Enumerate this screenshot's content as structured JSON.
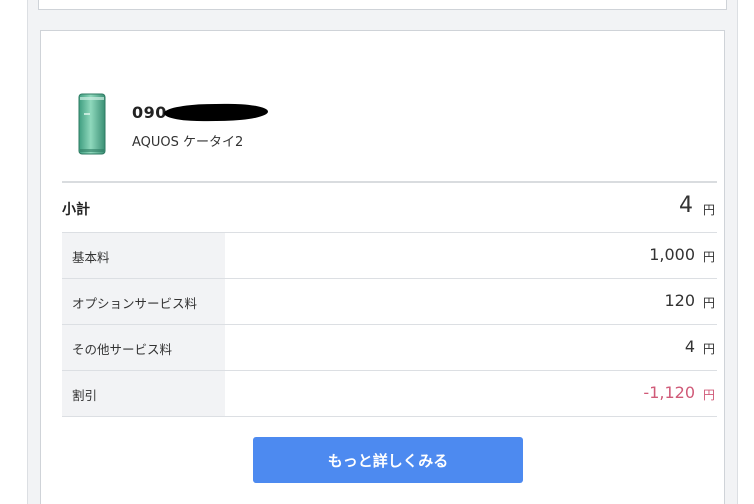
{
  "device": {
    "phone_number_prefix": "090",
    "model_name": "AQUOS ケータイ2",
    "icon": "flip-phone-icon"
  },
  "summary": {
    "subtotal_label": "小計",
    "subtotal_value": "4",
    "currency_unit": "円"
  },
  "breakdown": [
    {
      "label": "基本料",
      "value": "1,000",
      "unit": "円"
    },
    {
      "label": "オプションサービス料",
      "value": "120",
      "unit": "円"
    },
    {
      "label": "その他サービス料",
      "value": "4",
      "unit": "円"
    },
    {
      "label": "割引",
      "value": "-1,120",
      "unit": "円"
    }
  ],
  "actions": {
    "more_details_label": "もっと詳しくみる"
  },
  "colors": {
    "button": "#4d8af0",
    "discount": "#d05a78",
    "label_background": "#f2f3f5"
  }
}
